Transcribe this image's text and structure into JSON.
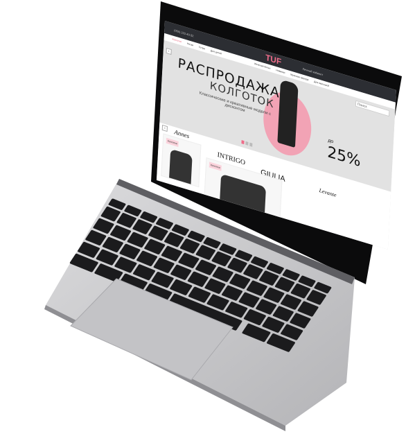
{
  "site": {
    "logo": "TUF",
    "phone": "(050) 222-40-32",
    "nav": [
      "Колготки",
      "Носки",
      "Гетры",
      "Для детей",
      "Женская белье",
      "Новинки",
      "Мужская одежда",
      "Для малышей"
    ],
    "account": "Личный кабинет",
    "search_placeholder": "Поиск"
  },
  "hero": {
    "title": "РАСПРОДАЖА",
    "subtitle": "КОЛГОТОК",
    "text": "Классические и креативные модели с дисконтом",
    "prefix": "до",
    "discount": "25%",
    "accent": "#f2a3b5"
  },
  "brands": [
    "Annes",
    "INTRIGO",
    "GIULIA",
    "Levante"
  ],
  "cards": [
    "Колготки",
    "Колготки"
  ],
  "colors": {
    "body": "#c8c8ca",
    "keys": "#1b1b1d",
    "bezel": "#0a0a0a"
  }
}
